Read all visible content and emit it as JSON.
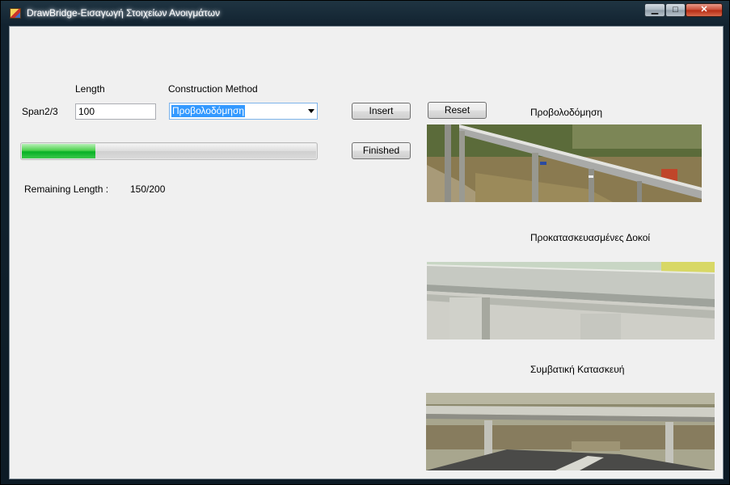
{
  "window": {
    "title": "DrawBridge-Εισαγωγή Στοιχείων Ανοιγμάτων",
    "controls": {
      "minimize": "▁",
      "maximize": "□",
      "close": "✕"
    }
  },
  "form": {
    "length_header": "Length",
    "method_header": "Construction Method",
    "span_label": "Span2/3",
    "length_value": "100",
    "method_selected": "Προβολοδόμηση",
    "insert_label": "Insert",
    "reset_label": "Reset",
    "finished_label": "Finished",
    "progress_fraction": 0.25,
    "remaining_label": "Remaining Length :",
    "remaining_value": "150/200"
  },
  "gallery": {
    "items": [
      {
        "caption": "Προβολοδόμηση",
        "icon": "cantilever-bridge-photo"
      },
      {
        "caption": "Προκατασκευασμένες Δοκοί",
        "icon": "precast-beam-bridge-photo"
      },
      {
        "caption": "Συμβατική Κατασκευή",
        "icon": "conventional-bridge-photo"
      }
    ]
  }
}
